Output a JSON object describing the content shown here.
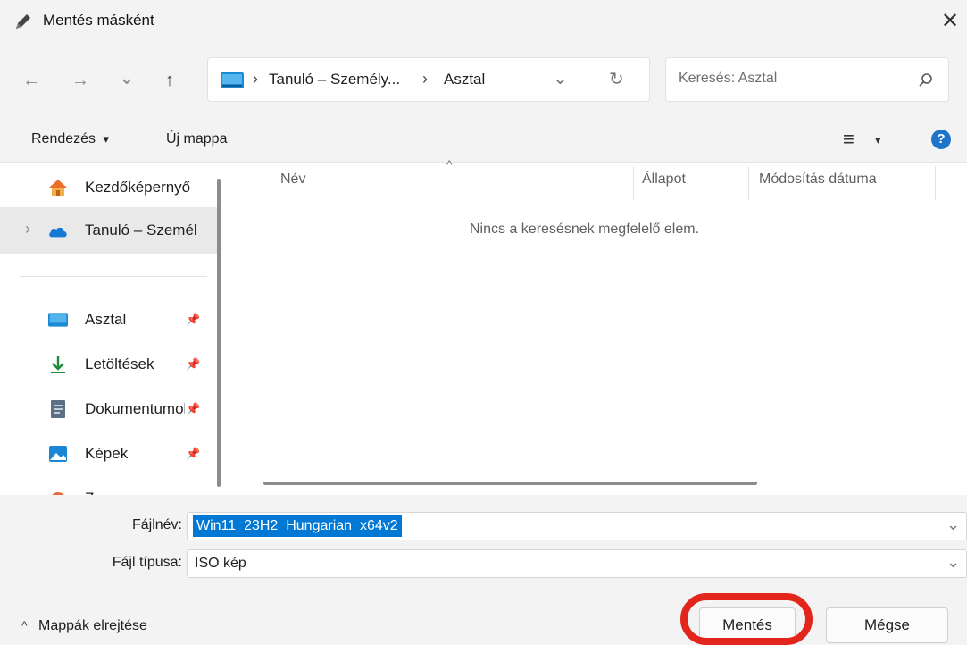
{
  "window": {
    "title": "Mentés másként",
    "close": "✕"
  },
  "nav": {
    "back": "←",
    "forward": "→",
    "recent": "⌄",
    "up": "↑",
    "breadcrumb": [
      "Tanuló – Személy...",
      "Asztal"
    ],
    "crumb_sep": "›",
    "dropdown": "⌄",
    "refresh": "↻",
    "search_placeholder": "Keresés: Asztal"
  },
  "toolbar": {
    "organize": "Rendezés",
    "organize_caret": "▾",
    "new_folder": "Új mappa",
    "view_icon": "≡",
    "view_caret": "▾",
    "help": "?"
  },
  "sidebar": {
    "items": [
      {
        "label": "Kezdőképernyő",
        "icon": "home-icon"
      },
      {
        "label": "Tanuló – Személ",
        "icon": "onedrive-icon"
      },
      {
        "label": "Asztal",
        "icon": "desktop-icon"
      },
      {
        "label": "Letöltések",
        "icon": "download-icon"
      },
      {
        "label": "Dokumentumok",
        "icon": "document-icon"
      },
      {
        "label": "Képek",
        "icon": "pictures-icon"
      },
      {
        "label": "Z",
        "icon": "music-icon"
      }
    ],
    "expander": "›"
  },
  "file_list": {
    "columns": [
      "Név",
      "Állapot",
      "Módosítás dátuma"
    ],
    "sort_indicator": "^",
    "empty_message": "Nincs a keresésnek megfelelő elem."
  },
  "form": {
    "filename_label": "Fájlnév:",
    "filename_value": "Win11_23H2_Hungarian_x64v2",
    "filetype_label": "Fájl típusa:",
    "filetype_value": "ISO kép",
    "dropdown": "⌄"
  },
  "footer": {
    "hide_folders_caret": "^",
    "hide_folders": "Mappák elrejtése",
    "save": "Mentés",
    "cancel": "Mégse"
  },
  "colors": {
    "accent": "#0067c0",
    "highlight": "#e3261c",
    "selection": "#0078d4"
  }
}
